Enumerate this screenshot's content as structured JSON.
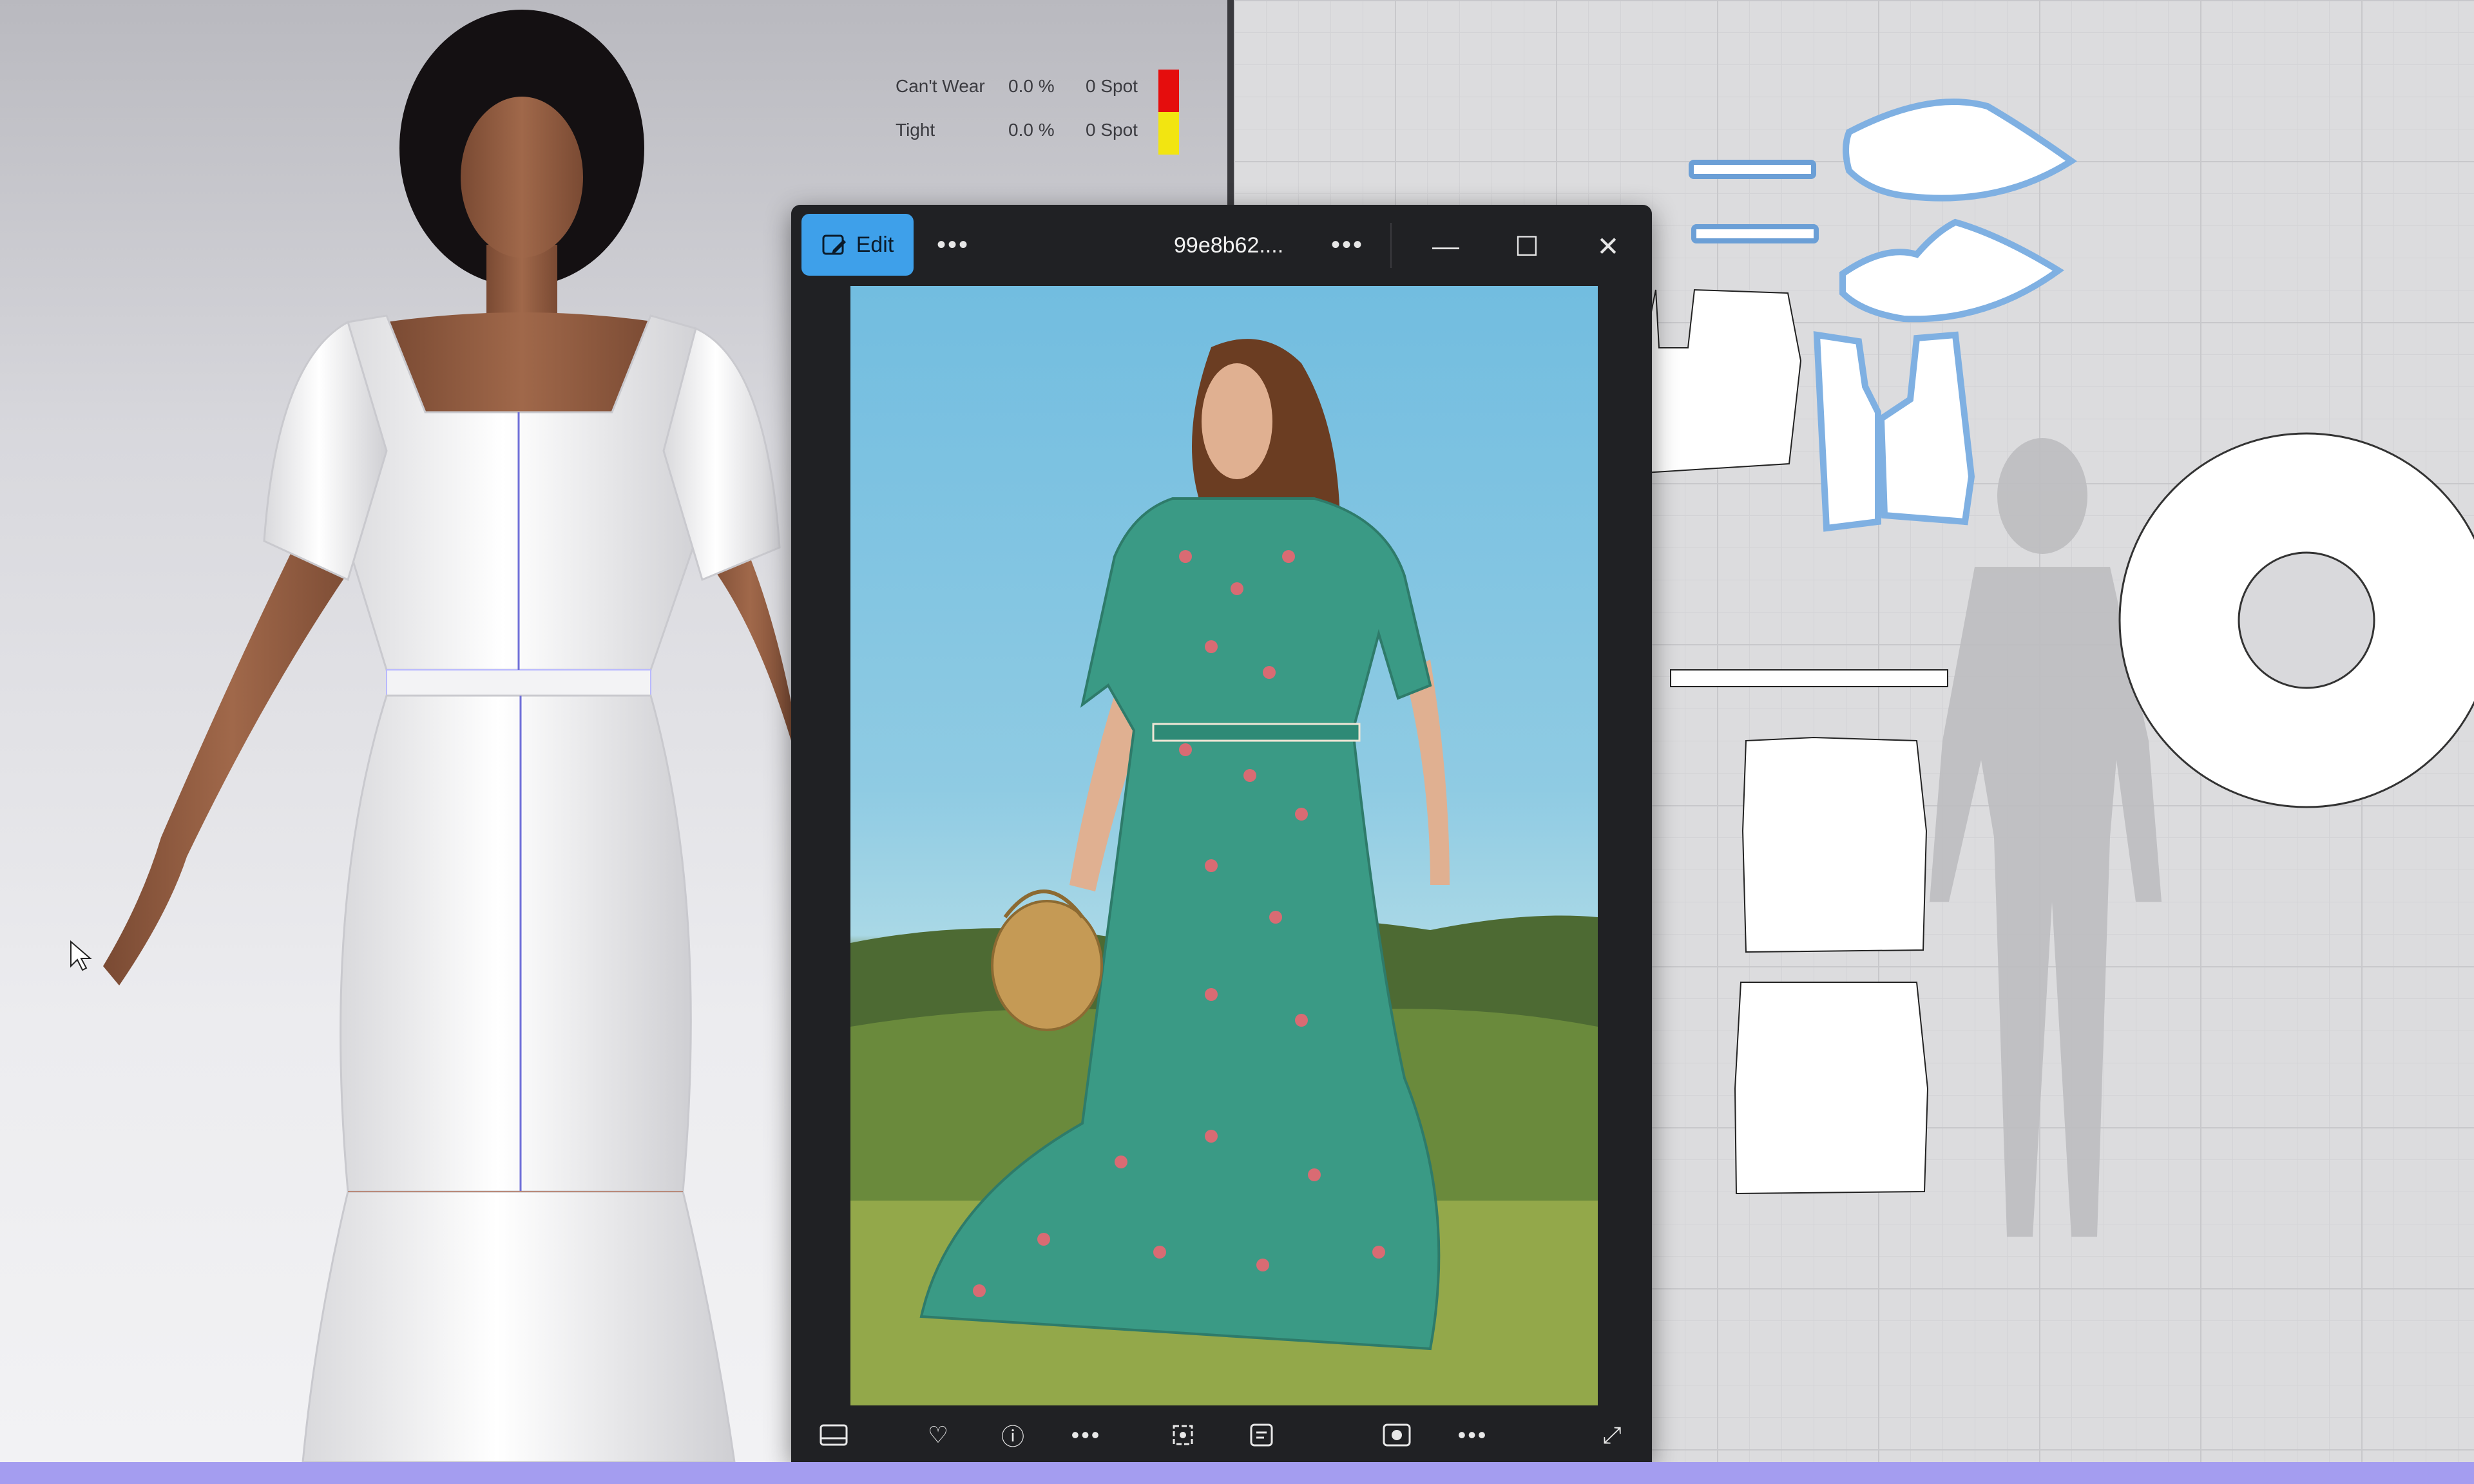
{
  "fit_map": {
    "rows": [
      {
        "label": "Can't Wear",
        "percent": "0.0 %",
        "spot": "0 Spot",
        "color": "#e50d0d"
      },
      {
        "label": "Tight",
        "percent": "0.0 %",
        "spot": "0 Spot",
        "color": "#f2e511"
      }
    ]
  },
  "toolstrip": {
    "icons": [
      "pen-icon",
      "garment-icon",
      "info-icon",
      "brush-icon"
    ]
  },
  "photo_viewer": {
    "edit_label": "Edit",
    "more_dots": "•••",
    "title": "99e8b62....",
    "minimize_glyph": "—",
    "maximize_glyph": "☐",
    "close_glyph": "✕",
    "bottom_icons": [
      "filmstrip-icon",
      "heart-icon",
      "info-icon",
      "more-icon",
      "crop-icon",
      "text-icon",
      "slideshow-icon",
      "more-icon",
      "fullscreen-icon"
    ]
  },
  "colors": {
    "accent": "#3ea0ea",
    "window_bg": "#202124",
    "bottom_strip": "#a49df0",
    "pattern_outline": "#6b9fd6"
  }
}
